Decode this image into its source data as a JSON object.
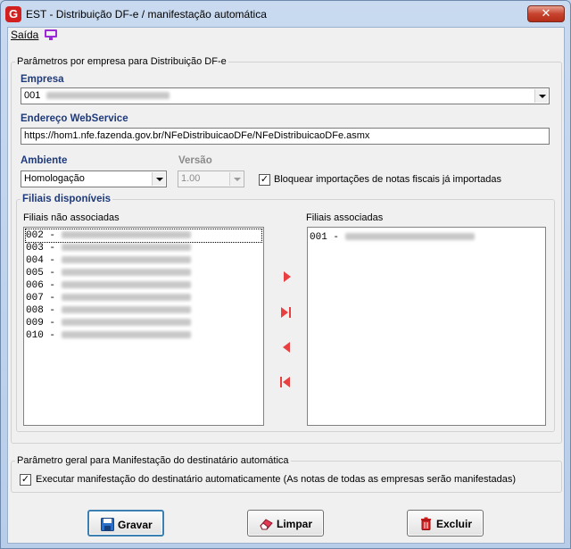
{
  "window": {
    "title": "EST - Distribuição DF-e / manifestação automática",
    "close_label": "✕"
  },
  "menu": {
    "saida": "Saída"
  },
  "params_group": {
    "legend": "Parâmetros por empresa para Distribuição DF-e",
    "empresa_label": "Empresa",
    "empresa_value": "001",
    "endereco_label": "Endereço WebService",
    "endereco_value": "https://hom1.nfe.fazenda.gov.br/NFeDistribuicaoDFe/NFeDistribuicaoDFe.asmx",
    "ambiente_label": "Ambiente",
    "ambiente_value": "Homologação",
    "versao_label": "Versão",
    "versao_value": "1.00",
    "bloquear_label": "Bloquear importações de notas fiscais já importadas",
    "bloquear_checked": true
  },
  "filiais_group": {
    "legend": "Filiais disponíveis",
    "nao_associadas_label": "Filiais não associadas",
    "associadas_label": "Filiais associadas",
    "nao_associadas": [
      "002 -",
      "003 -",
      "004 -",
      "005 -",
      "006 -",
      "007 -",
      "008 -",
      "009 -",
      "010 -"
    ],
    "associadas": [
      "001 -"
    ]
  },
  "manifest_group": {
    "legend": "Parâmetro geral para Manifestação do destinatário automática",
    "executar_label": "Executar manifestação do destinatário automaticamente (As notas de todas as empresas serão manifestadas)",
    "executar_checked": true
  },
  "buttons": {
    "gravar": "Gravar",
    "limpar": "Limpar",
    "excluir": "Excluir"
  },
  "icons": {
    "app": "app-logo-icon",
    "monitor": "monitor-icon",
    "add": "arrow-right-icon",
    "add_all": "arrow-right-end-icon",
    "remove": "arrow-left-icon",
    "remove_all": "arrow-left-end-icon",
    "save": "floppy-disk-icon",
    "clear": "eraser-icon",
    "delete": "trash-icon"
  },
  "colors": {
    "accent_red": "#e84040",
    "label_blue": "#1f3a7a"
  }
}
